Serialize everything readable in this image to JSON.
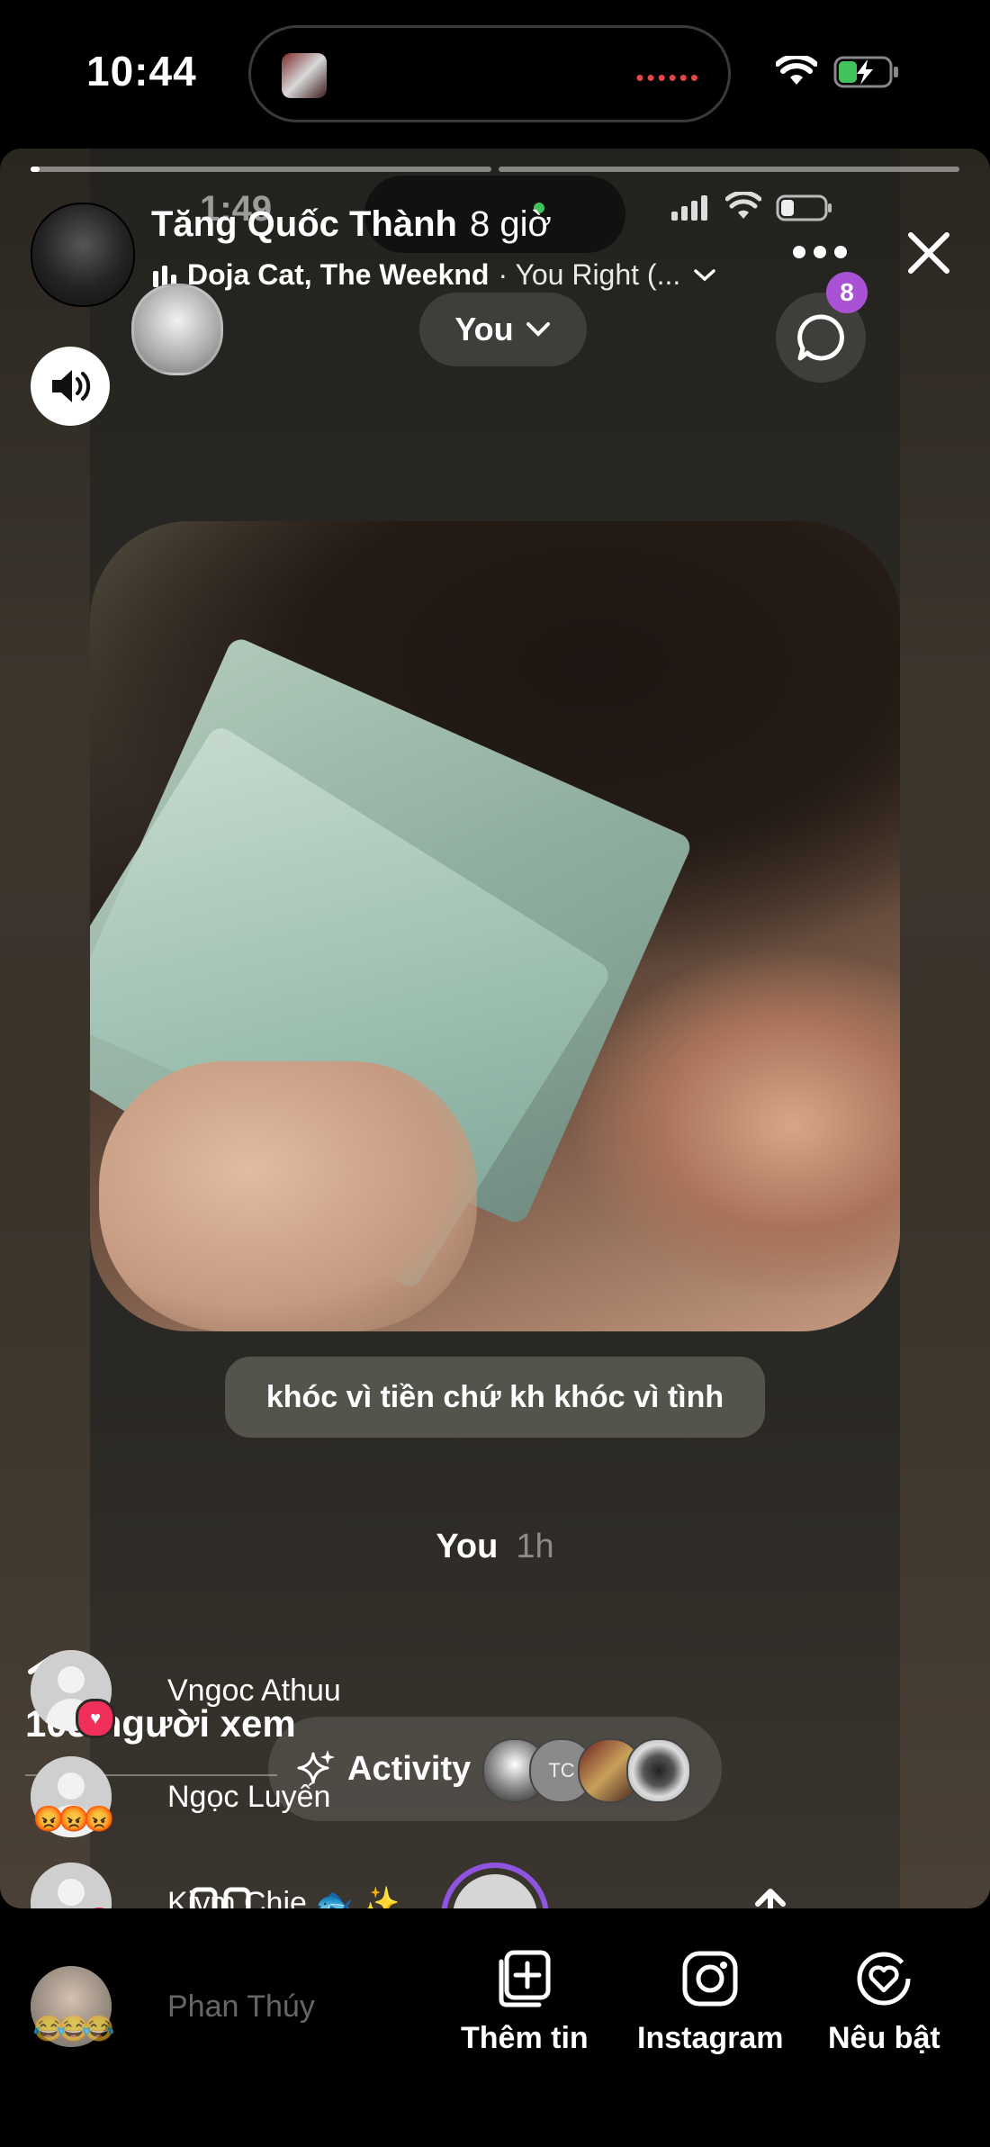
{
  "status_bar": {
    "time": "10:44",
    "island_dots": "••••••"
  },
  "inner_status": {
    "time": "1:49"
  },
  "story": {
    "username": "Tăng Quốc Thành",
    "posted_ago": "8 giờ",
    "music_artist": "Doja Cat, The Weeknd",
    "music_song": "· You Right (...",
    "audience_label": "You",
    "message_badge": "8",
    "caption": "khóc vì tiền chứ kh khóc vì tình",
    "replied_by": "You",
    "replied_ago": "1h",
    "progress": [
      1.0,
      0.0
    ]
  },
  "viewers": {
    "count_label": "103 người xem",
    "items": [
      {
        "name": "Vngoc Athuu",
        "reaction": "heart"
      },
      {
        "name": "Ngọc Luyến",
        "reaction": "😡"
      },
      {
        "name": "Kiym Chie 🐟 ✨",
        "reaction": "😂"
      },
      {
        "name": "Phan Thúy",
        "reaction": "😂"
      }
    ]
  },
  "activity": {
    "label": "Activity",
    "avatar_initials": "TC"
  },
  "bottom_bar": {
    "add_story": "Thêm tin",
    "instagram": "Instagram",
    "highlight": "Nêu bật"
  },
  "colors": {
    "accent": "#a952d6",
    "capture_ring": "#8f55e0",
    "heart": "#f0305a"
  }
}
